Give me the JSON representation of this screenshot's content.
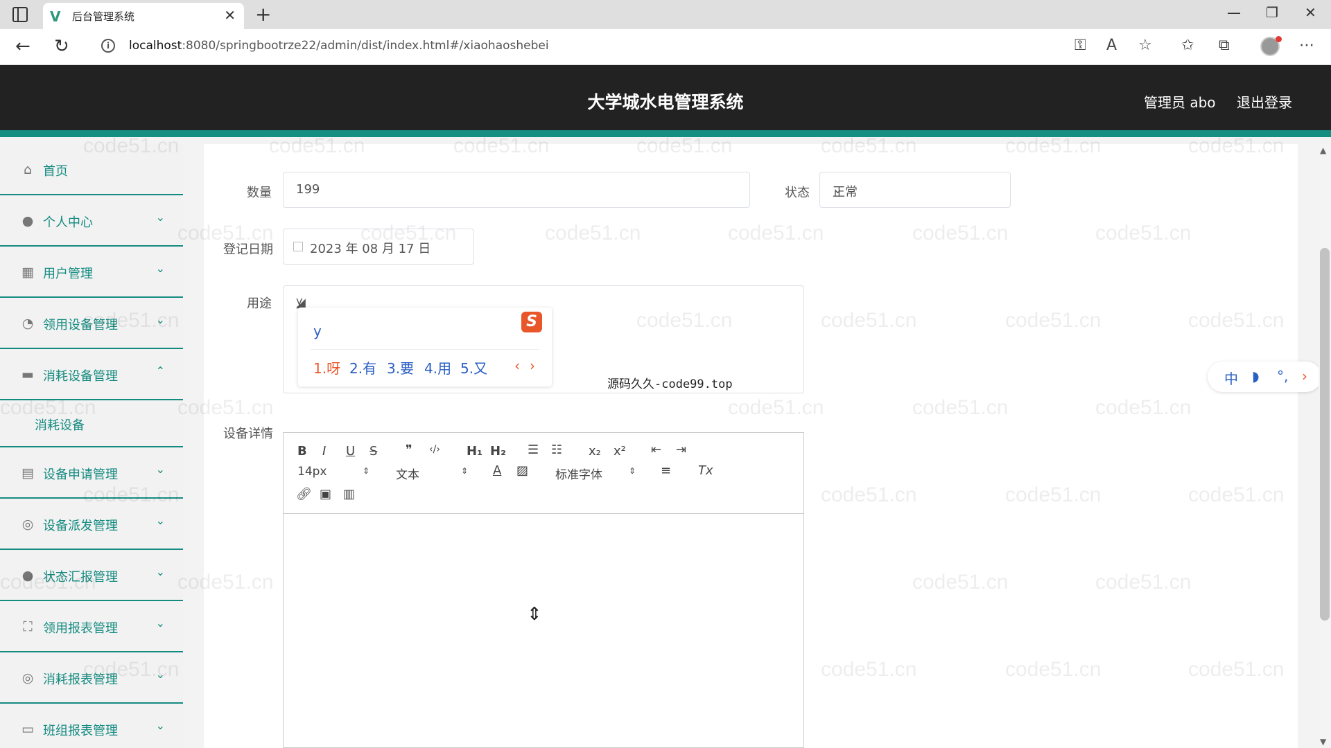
{
  "browser": {
    "tab_title": "后台管理系统",
    "tab_logo": "V",
    "url_host": "localhost",
    "url_path": ":8080/springbootrze22/admin/dist/index.html#/xiaohaoshebei"
  },
  "header": {
    "title": "大学城水电管理系统",
    "user": "管理员 abo",
    "logout": "退出登录"
  },
  "sidebar": {
    "items": [
      {
        "label": "首页",
        "icon": "home-icon"
      },
      {
        "label": "个人中心",
        "icon": "user-icon"
      },
      {
        "label": "用户管理",
        "icon": "grid-icon"
      },
      {
        "label": "领用设备管理",
        "icon": "clock-icon"
      },
      {
        "label": "消耗设备管理",
        "icon": "monitor-icon"
      },
      {
        "label": "设备申请管理",
        "icon": "clipboard-icon"
      },
      {
        "label": "设备派发管理",
        "icon": "compass-icon"
      },
      {
        "label": "状态汇报管理",
        "icon": "user-icon"
      },
      {
        "label": "领用报表管理",
        "icon": "fullscreen-icon"
      },
      {
        "label": "消耗报表管理",
        "icon": "compass-icon"
      },
      {
        "label": "班组报表管理",
        "icon": "card-icon"
      }
    ],
    "submenu_label": "消耗设备"
  },
  "form": {
    "quantity_label": "数量",
    "quantity_value": "199",
    "status_label": "状态",
    "status_value": "正常",
    "date_label": "登记日期",
    "date_value": "2023 年 08 月 17 日",
    "usage_label": "用途",
    "usage_value": "y",
    "detail_label": "设备详情"
  },
  "ime": {
    "composition": "y",
    "candidates": [
      "1.呀",
      "2.有",
      "3.要",
      "4.用",
      "5.又"
    ],
    "logo": "S",
    "prev": "‹",
    "next": "›"
  },
  "overlay_text": "源码久久-code99.top",
  "editor": {
    "font_size": "14px",
    "paragraph": "文本",
    "font_family": "标准字体",
    "buttons": [
      "B",
      "I",
      "U",
      "S",
      "❞",
      "‹/›",
      "H₁",
      "H₂",
      "x₂",
      "x²",
      "Tx"
    ]
  },
  "ime_bar": [
    "中",
    "◗",
    "°,",
    "›"
  ],
  "watermark": "code51.cn"
}
